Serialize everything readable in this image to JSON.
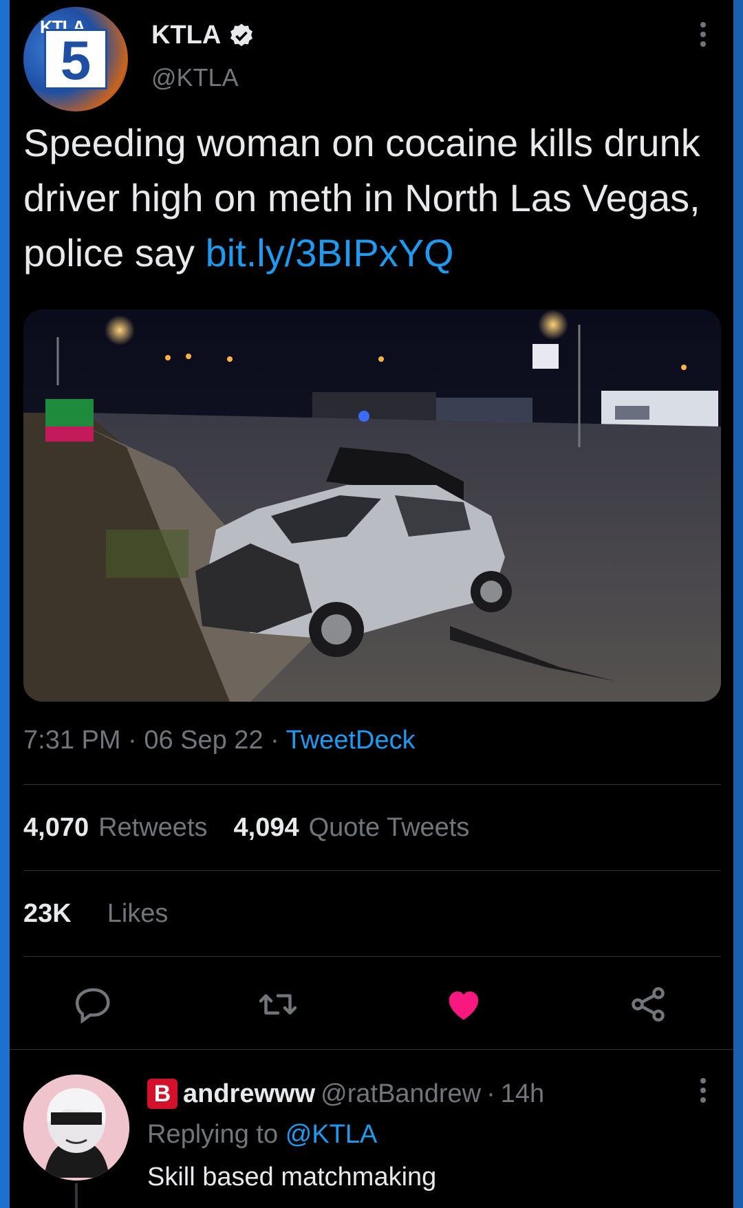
{
  "author": {
    "display_name": "KTLA",
    "handle": "@KTLA",
    "avatar_brand": "KTLA",
    "avatar_number": "5",
    "verified": true
  },
  "tweet": {
    "text": "Speeding woman on cocaine kills drunk driver high on meth in North Las Vegas, police say ",
    "link": "bit.ly/3BIPxYQ",
    "time": "7:31 PM",
    "date": "06 Sep 22",
    "separator": "·",
    "source": "TweetDeck"
  },
  "stats": {
    "retweets_count": "4,070",
    "retweets_label": "Retweets",
    "quotes_count": "4,094",
    "quotes_label": "Quote Tweets",
    "likes_count": "23K",
    "likes_label": "Likes"
  },
  "actions": [
    "reply-icon",
    "retweet-icon",
    "like-icon",
    "share-icon"
  ],
  "colors": {
    "link": "#1d9bf0",
    "like": "#f91880",
    "frame": "#1d6fd0"
  },
  "reply": {
    "badge": "B",
    "name": "andrewww",
    "handle": "@ratBandrew",
    "separator": "·",
    "time": "14h",
    "replying_prefix": "Replying to",
    "replying_to": "@KTLA",
    "text": "Skill based matchmaking"
  }
}
